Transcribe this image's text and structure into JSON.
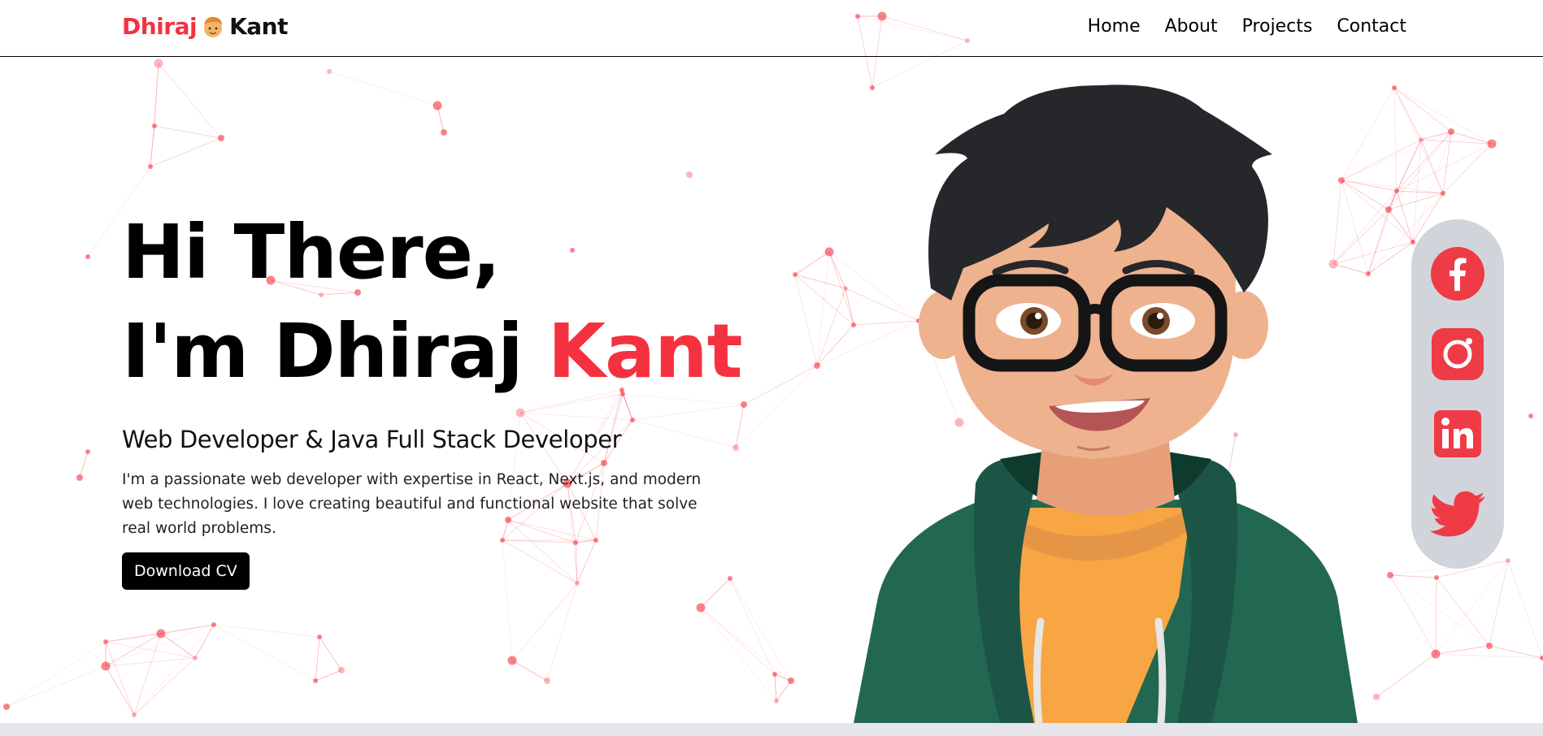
{
  "nav": {
    "logo_first": "Dhiraj",
    "logo_last": "Kant",
    "logo_icon": "boy-face-icon",
    "links": [
      "Home",
      "About",
      "Projects",
      "Contact"
    ]
  },
  "hero": {
    "greeting": "Hi There,",
    "intro_prefix": "I'm Dhiraj",
    "intro_accent": "Kant",
    "subtitle": "Web Developer & Java Full Stack Developer",
    "description": "I'm a passionate web developer with expertise in React, Next.js, and modern web technologies. I love creating beautiful and functional website that solve real world problems.",
    "cta": "Download CV"
  },
  "social": {
    "icons": [
      "facebook-icon",
      "instagram-icon",
      "linkedin-icon",
      "twitter-icon"
    ]
  },
  "colors": {
    "accent": "#f5313f",
    "social_bg": "#d1d5db",
    "hoodie": "#226752",
    "shirt": "#f7a643",
    "skin": "#efb28f",
    "hair": "#25272b"
  }
}
